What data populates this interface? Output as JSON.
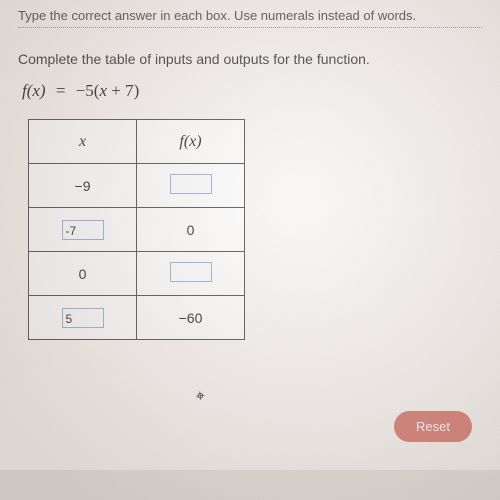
{
  "top_instruction": "Type the correct answer in each box. Use numerals instead of words.",
  "question": "Complete the table of inputs and outputs for the function.",
  "formula": {
    "lhs": "f(x)",
    "eq": "=",
    "rhs": "−5(x + 7)"
  },
  "table": {
    "headers": {
      "col1": "x",
      "col2": "f(x)"
    },
    "rows": [
      {
        "x": "−9",
        "x_input": false,
        "fx": "",
        "fx_input": true
      },
      {
        "x": "-7",
        "x_input": true,
        "fx": "0",
        "fx_input": false
      },
      {
        "x": "0",
        "x_input": false,
        "fx": "",
        "fx_input": true
      },
      {
        "x": "5",
        "x_input": true,
        "fx": "−60",
        "fx_input": false
      }
    ]
  },
  "reset_label": "Reset",
  "chart_data": {
    "type": "table",
    "title": "Function input/output table for f(x) = -5(x + 7)",
    "columns": [
      "x",
      "f(x)"
    ],
    "rows": [
      {
        "x": -9,
        "fx": null,
        "editable": "fx"
      },
      {
        "x": -7,
        "fx": 0,
        "editable": "x"
      },
      {
        "x": 0,
        "fx": null,
        "editable": "fx"
      },
      {
        "x": 5,
        "fx": -60,
        "editable": "x"
      }
    ]
  }
}
